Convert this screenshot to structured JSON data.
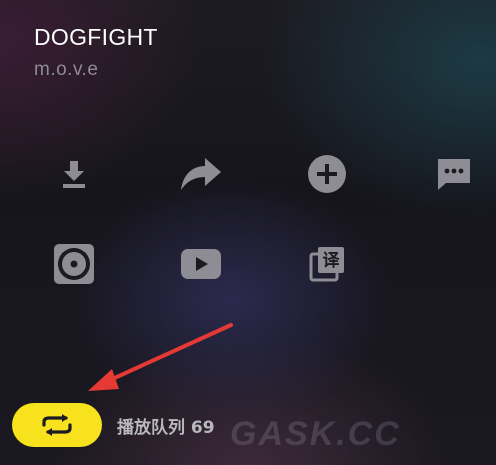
{
  "song": {
    "title": "DOGFIGHT",
    "artist": "m.o.v.e"
  },
  "actions_row1": [
    {
      "icon": "download-icon"
    },
    {
      "icon": "share-icon"
    },
    {
      "icon": "add-circle-icon"
    },
    {
      "icon": "comment-icon"
    }
  ],
  "actions_row2": [
    {
      "icon": "vinyl-disc-icon"
    },
    {
      "icon": "video-play-icon"
    },
    {
      "icon": "translate-icon",
      "glyph": "译"
    }
  ],
  "queue": {
    "label": "播放队列 69"
  },
  "watermark": "GASK.CC",
  "colors": {
    "accent": "#f7e21d",
    "arrow": "#e53935",
    "icon": "#8e8c94"
  }
}
